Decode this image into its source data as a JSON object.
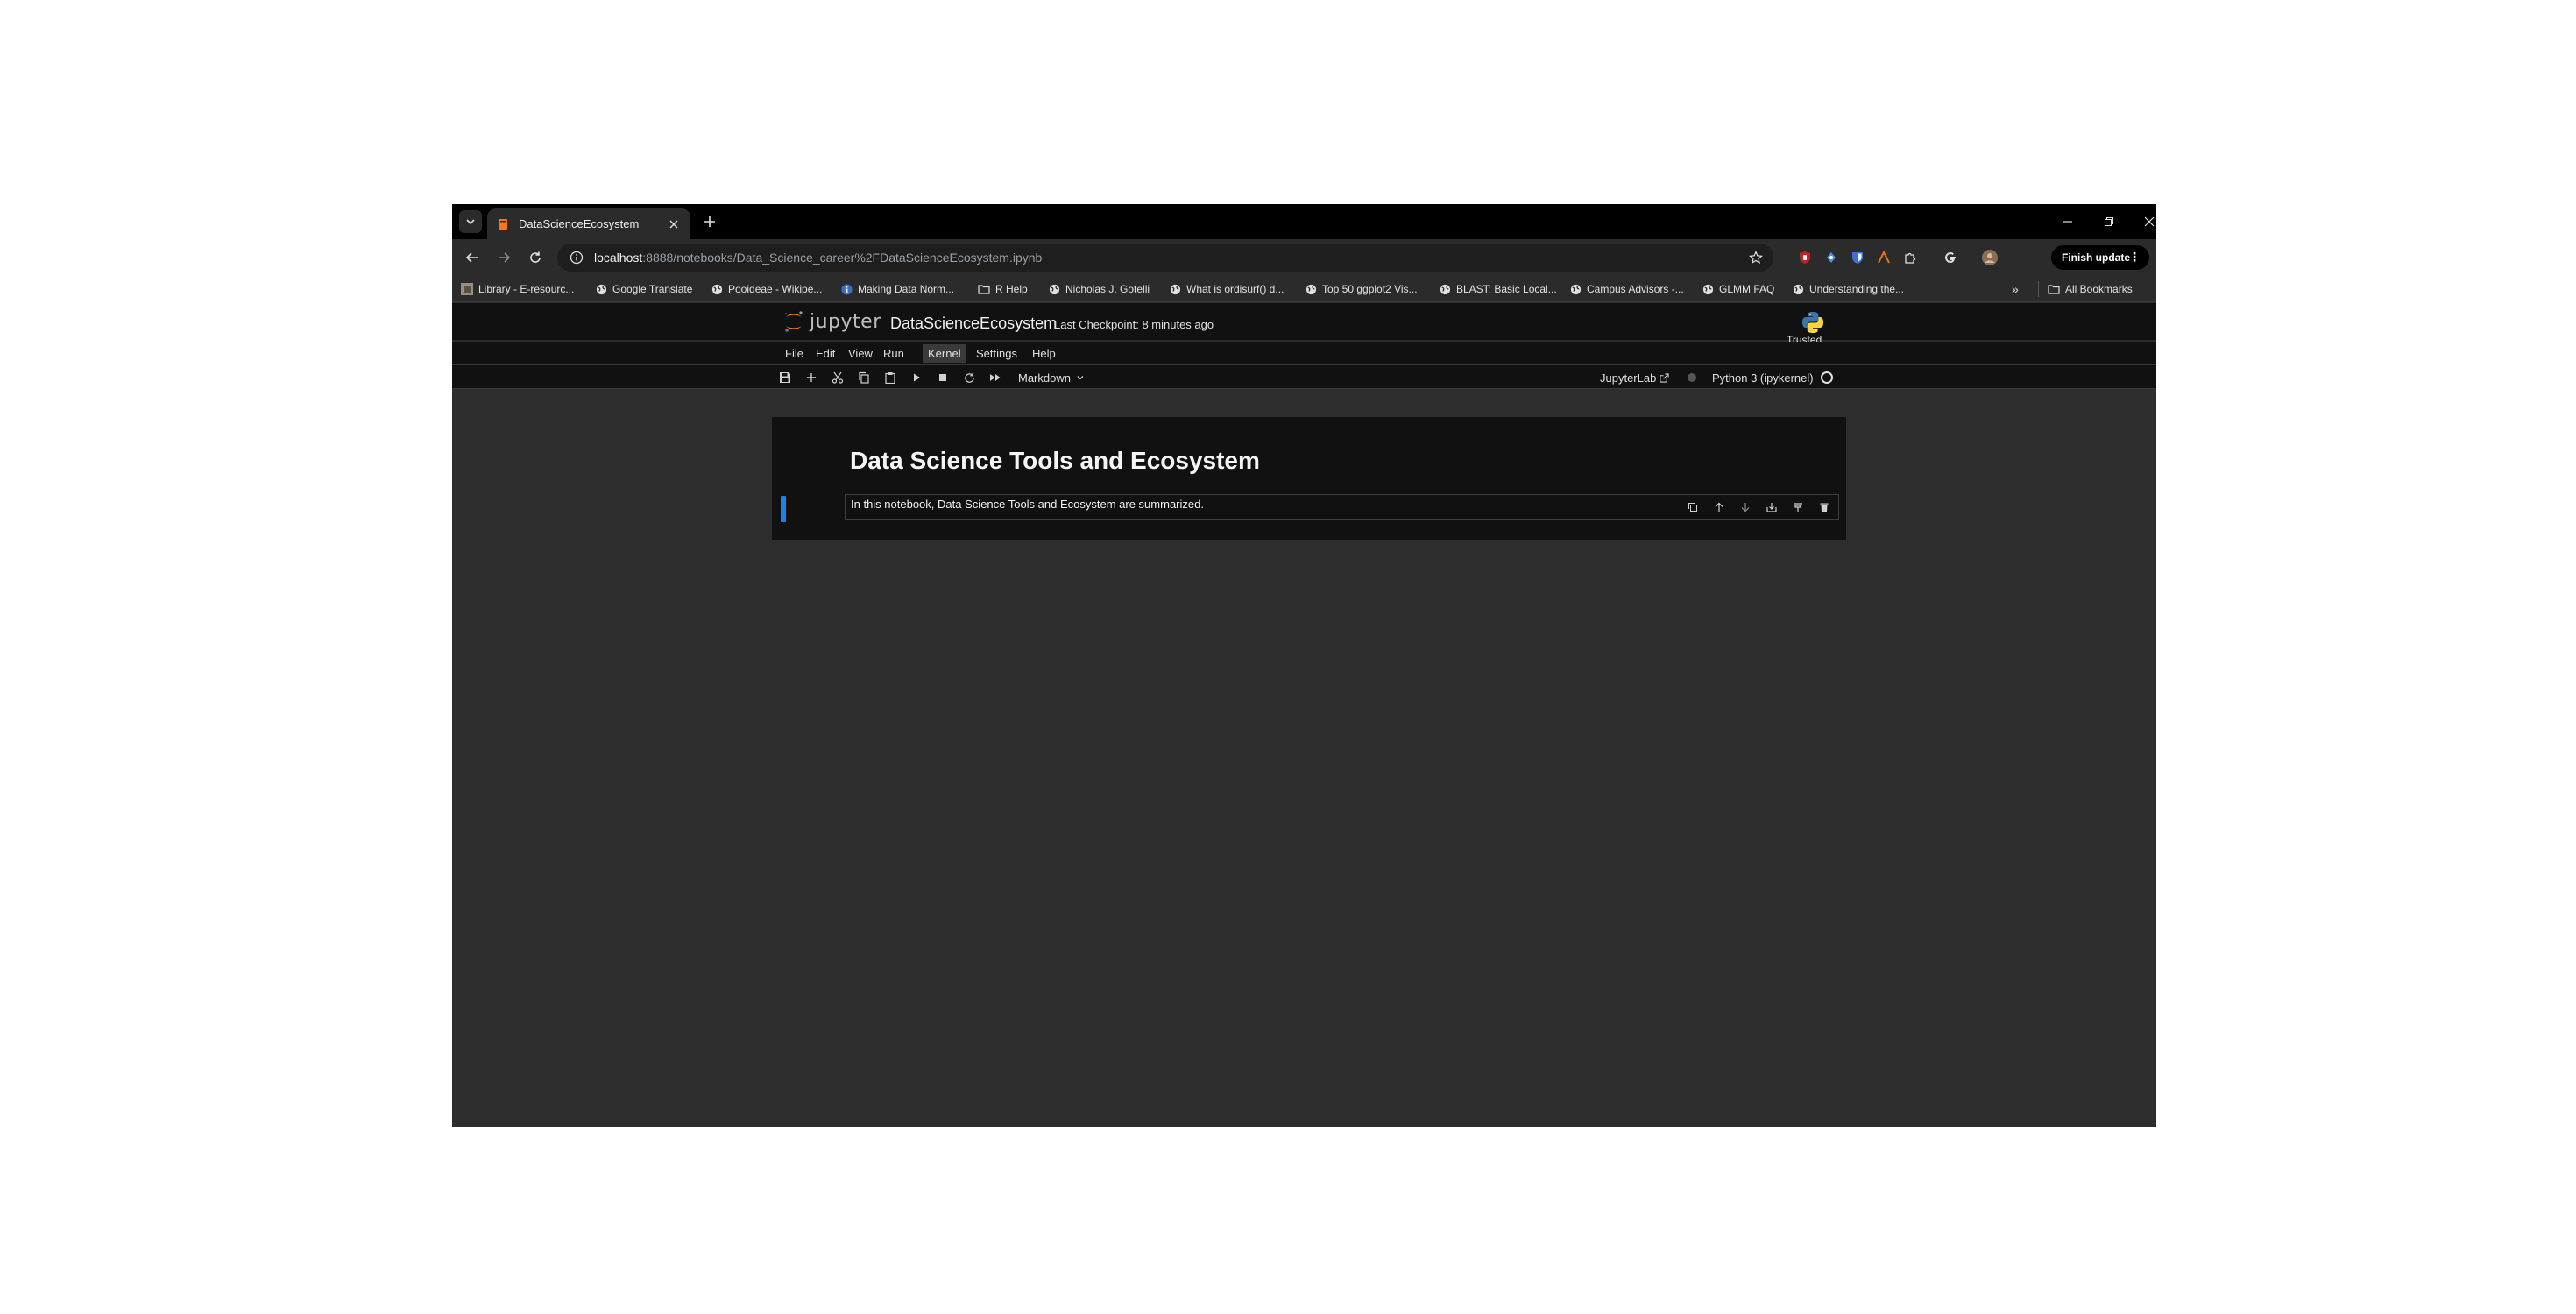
{
  "browser": {
    "tab": {
      "title": "DataScienceEcosystem"
    },
    "address": {
      "host": "localhost",
      "rest": ":8888/notebooks/Data_Science_career%2FDataScienceEcosystem.ipynb"
    },
    "finish_update_label": "Finish update",
    "bookmarks": [
      {
        "label": "Library - E-resourc...",
        "icon": "library-favicon"
      },
      {
        "label": "Google Translate",
        "icon": "globe-icon"
      },
      {
        "label": "Pooideae - Wikipe...",
        "icon": "globe-icon"
      },
      {
        "label": "Making Data Norm...",
        "icon": "info-favicon"
      },
      {
        "label": "R Help",
        "icon": "folder-icon"
      },
      {
        "label": "Nicholas J. Gotelli",
        "icon": "globe-icon"
      },
      {
        "label": "What is ordisurf() d...",
        "icon": "globe-icon"
      },
      {
        "label": "Top 50 ggplot2 Vis...",
        "icon": "globe-icon"
      },
      {
        "label": "BLAST: Basic Local...",
        "icon": "globe-icon"
      },
      {
        "label": "Campus Advisors -...",
        "icon": "globe-icon"
      },
      {
        "label": "GLMM FAQ",
        "icon": "globe-icon"
      },
      {
        "label": "Understanding the...",
        "icon": "globe-icon"
      }
    ],
    "all_bookmarks_label": "All Bookmarks"
  },
  "jupyter": {
    "logo_text": "jupyter",
    "notebook_title": "DataScienceEcosystem",
    "checkpoint": "Last Checkpoint: 8 minutes ago",
    "trusted": "Trusted",
    "menu": [
      "File",
      "Edit",
      "View",
      "Run",
      "Kernel",
      "Settings",
      "Help"
    ],
    "active_menu": "Kernel",
    "cell_type": "Markdown",
    "jupyterlab_label": "JupyterLab",
    "kernel_name": "Python 3 (ipykernel)"
  },
  "notebook": {
    "heading": "Data Science Tools and Ecosystem",
    "cell_text": "In this notebook, Data Science Tools and Ecosystem are summarized."
  },
  "colors": {
    "accent": "#1a84e6",
    "jupyter_orange": "#f37726",
    "background": "#2d2d2d"
  }
}
